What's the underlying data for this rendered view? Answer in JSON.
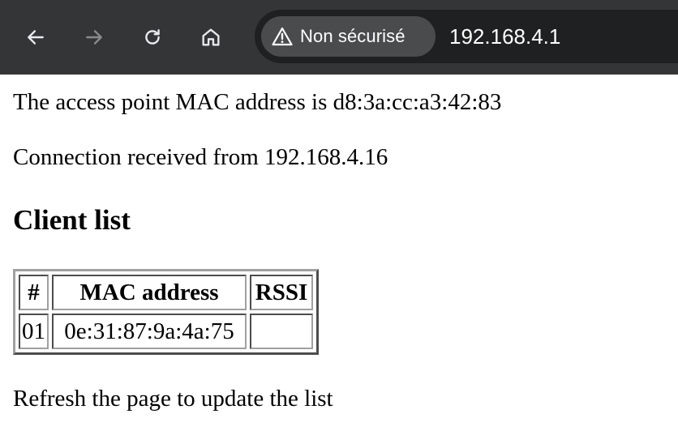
{
  "browser": {
    "security_label": "Non sécurisé",
    "url": "192.168.4.1",
    "icons": [
      "back-arrow-icon",
      "forward-arrow-icon",
      "reload-icon",
      "home-icon",
      "warning-triangle-icon"
    ],
    "colors": {
      "toolbar_bg": "#343536",
      "omnibox_bg": "#1f2021",
      "chip_bg": "#4a4b4d"
    }
  },
  "page": {
    "mac_line": "The access point MAC address is d8:3a:cc:a3:42:83",
    "connection_line": "Connection received from 192.168.4.16",
    "heading": "Client list",
    "table": {
      "headers": [
        "#",
        "MAC address",
        "RSSI"
      ],
      "rows": [
        [
          "01",
          "0e:31:87:9a:4a:75",
          ""
        ]
      ]
    },
    "refresh_line": "Refresh the page to update the list"
  }
}
